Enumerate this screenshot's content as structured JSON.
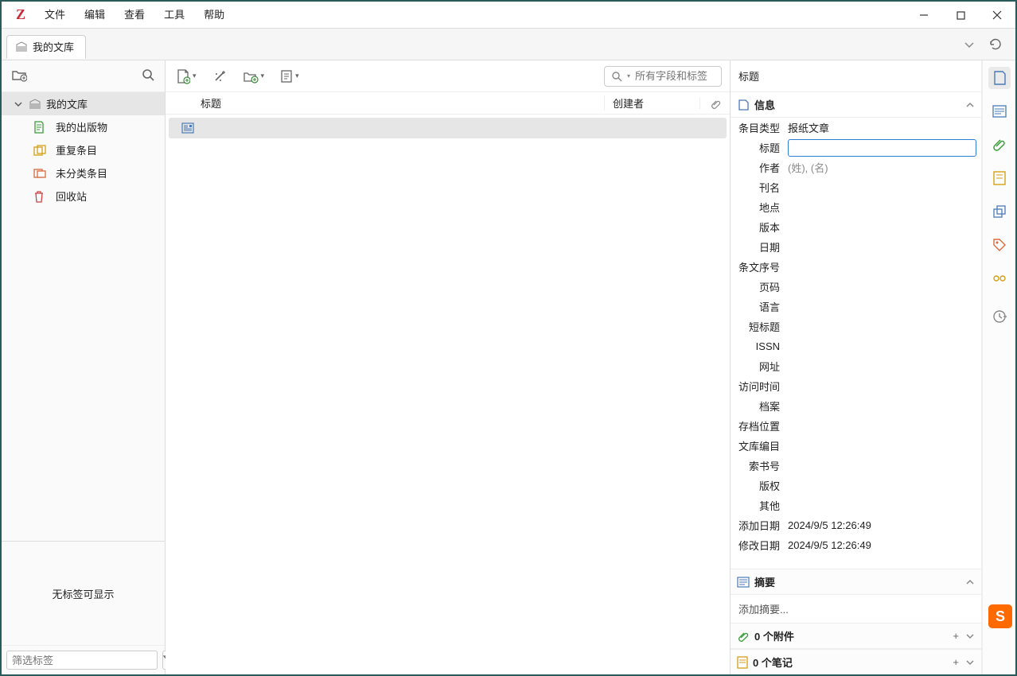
{
  "menubar": {
    "items": [
      "文件",
      "编辑",
      "查看",
      "工具",
      "帮助"
    ]
  },
  "tabbar": {
    "tab_label": "我的文库"
  },
  "left": {
    "root_label": "我的文库",
    "items": [
      {
        "label": "我的出版物",
        "color": "#3a9e3a"
      },
      {
        "label": "重复条目",
        "color": "#d4a017"
      },
      {
        "label": "未分类条目",
        "color": "#d86b3d"
      },
      {
        "label": "回收站",
        "color": "#c44"
      }
    ],
    "no_tags": "无标签可显示",
    "tag_filter_placeholder": "筛选标签"
  },
  "center": {
    "search_placeholder": "所有字段和标签",
    "col_title": "标题",
    "col_creator": "创建者"
  },
  "right": {
    "header": "标题",
    "info_title": "信息",
    "item_type_label": "条目类型",
    "item_type_value": "报纸文章",
    "fields": [
      {
        "label": "标题",
        "value": "",
        "is_input": true
      },
      {
        "label": "作者",
        "value": "(姓), (名)",
        "placeholder": true
      },
      {
        "label": "刊名",
        "value": ""
      },
      {
        "label": "地点",
        "value": ""
      },
      {
        "label": "版本",
        "value": ""
      },
      {
        "label": "日期",
        "value": ""
      },
      {
        "label": "条文序号",
        "value": ""
      },
      {
        "label": "页码",
        "value": ""
      },
      {
        "label": "语言",
        "value": ""
      },
      {
        "label": "短标题",
        "value": ""
      },
      {
        "label": "ISSN",
        "value": ""
      },
      {
        "label": "网址",
        "value": ""
      },
      {
        "label": "访问时间",
        "value": ""
      },
      {
        "label": "档案",
        "value": ""
      },
      {
        "label": "存档位置",
        "value": ""
      },
      {
        "label": "文库编目",
        "value": ""
      },
      {
        "label": "索书号",
        "value": ""
      },
      {
        "label": "版权",
        "value": ""
      },
      {
        "label": "其他",
        "value": ""
      },
      {
        "label": "添加日期",
        "value": "2024/9/5 12:26:49"
      },
      {
        "label": "修改日期",
        "value": "2024/9/5 12:26:49"
      }
    ],
    "abstract_title": "摘要",
    "abstract_placeholder": "添加摘要...",
    "attachments_title": "0 个附件",
    "notes_title": "0 个笔记"
  },
  "ime_badge": "S"
}
